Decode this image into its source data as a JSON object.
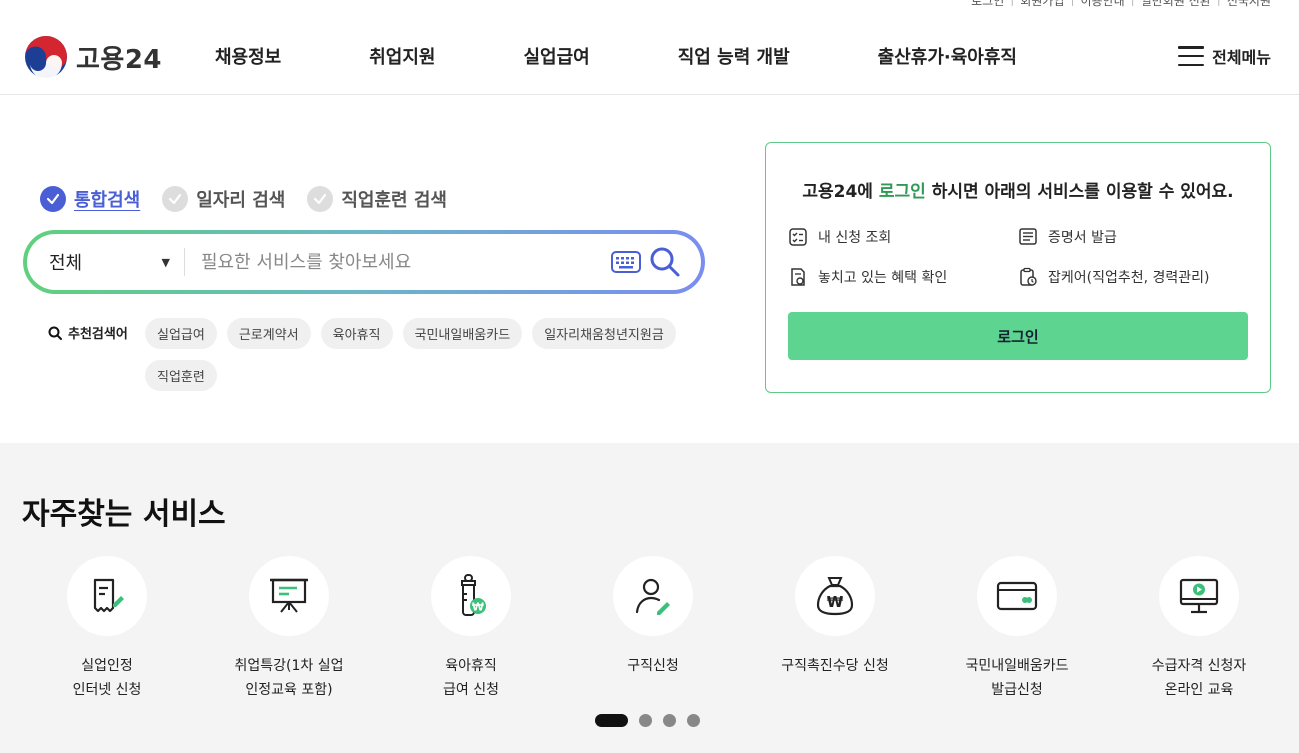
{
  "util_links": [
    "로그인",
    "회원가입",
    "이용안내",
    "일반회원 전환",
    "전국지원"
  ],
  "header": {
    "logo_text": "고용24",
    "nav": [
      "채용정보",
      "취업지원",
      "실업급여",
      "직업 능력 개발",
      "출산휴가·육아휴직"
    ],
    "menu_all": "전체메뉴"
  },
  "search": {
    "tabs": [
      {
        "label": "통합검색",
        "active": true
      },
      {
        "label": "일자리 검색",
        "active": false
      },
      {
        "label": "직업훈련 검색",
        "active": false
      }
    ],
    "category": "전체",
    "placeholder": "필요한 서비스를 찾아보세요",
    "recommend_label": "추천검색어",
    "chips": [
      "실업급여",
      "근로계약서",
      "육아휴직",
      "국민내일배움카드",
      "일자리채움청년지원금",
      "직업훈련"
    ]
  },
  "login_card": {
    "title_pre": "고용24에 ",
    "title_accent": "로그인",
    "title_post": " 하시면 아래의 서비스를 이용할 수 있어요.",
    "services": [
      "내 신청 조회",
      "증명서 발급",
      "놓치고 있는 혜택 확인",
      "잡케어(직업추천, 경력관리)"
    ],
    "button": "로그인"
  },
  "frequent": {
    "title": "자주찾는 서비스",
    "items": [
      {
        "label": "실업인정\n인터넷 신청",
        "icon": "document-pen-icon"
      },
      {
        "label": "취업특강(1차 실업\n인정교육 포함)",
        "icon": "presentation-board-icon"
      },
      {
        "label": "육아휴직\n급여 신청",
        "icon": "baby-bottle-won-icon"
      },
      {
        "label": "구직신청",
        "icon": "person-pen-icon"
      },
      {
        "label": "구직촉진수당 신청",
        "icon": "money-bag-won-icon"
      },
      {
        "label": "국민내일배움카드\n발급신청",
        "icon": "card-icon"
      },
      {
        "label": "수급자격 신청자\n온라인 교육",
        "icon": "monitor-play-icon"
      }
    ],
    "pager": {
      "pages": 4,
      "current": 1
    }
  },
  "colors": {
    "accent_blue": "#4a5fd6",
    "accent_green": "#2e9a55",
    "login_button": "#5dd48f"
  }
}
